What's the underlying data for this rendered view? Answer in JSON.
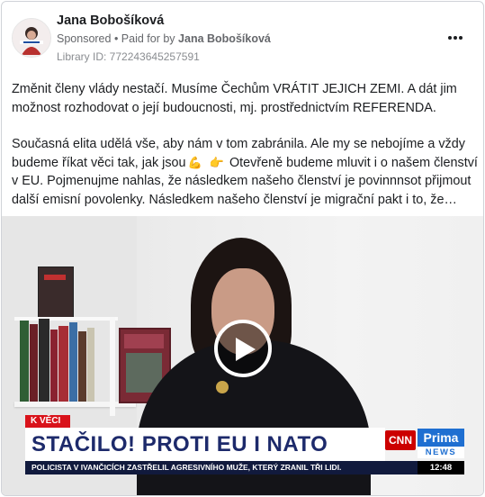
{
  "post": {
    "author": "Jana Bobošíková",
    "sponsored_label": "Sponsored",
    "paid_for_prefix": "• Paid for by",
    "paid_for_name": "Jana Bobošíková",
    "library_id": "Library ID: 772243645257591",
    "paragraph1": "Změnit členy vlády nestačí. Musíme Čechům VRÁTIT JEJICH ZEMI. A dát jim možnost rozhodovat o její budoucnosti, mj. prostřednictvím REFERENDA.",
    "paragraph2_part1": "Současná elita udělá vše, aby nám v tom zabránila. Ale my se nebojíme a vždy budeme říkat věci tak, jak jsou",
    "paragraph2_part2": "Otevřeně budeme mluvit i o našem členství v EU. Pojmenujme nahlas, že následkem našeho členství je povinnnsot přijmout další emisní povolenky. Následkem našeho členství je migrační pakt i to, že…",
    "emoji1": "💪",
    "emoji2": "👉",
    "more_icon": "more-options-icon"
  },
  "video": {
    "segment_tag": "K VĚCI",
    "headline": "STAČILO! PROTI EU I NATO",
    "ticker": "POLICISTA V IVANČICÍCH ZASTŘELIL AGRESIVNÍHO MUŽE, KTERÝ ZRANIL TŘI LIDI.",
    "clock": "12:48",
    "logo_cnn": "CNN",
    "logo_prima": "Prima",
    "logo_news": "NEWS",
    "play_icon": "play-icon",
    "accent_red": "#d9121a",
    "accent_blue": "#1f6fd1"
  }
}
